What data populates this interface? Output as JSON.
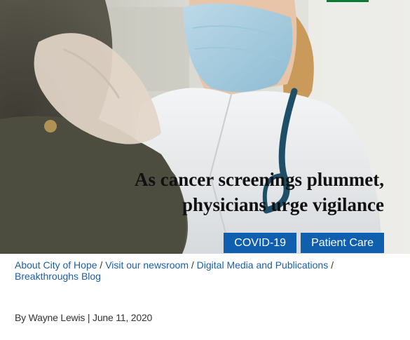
{
  "colors": {
    "tag_bg": "#0f5fae",
    "link": "#1c5fa8",
    "accent_green": "#0a7a3a",
    "headline": "#111111"
  },
  "hero": {
    "headline_line1": "As cancer screenings plummet,",
    "headline_line2": "physicians urge vigilance",
    "tags": [
      "COVID-19",
      "Patient Care"
    ]
  },
  "breadcrumb": {
    "items": [
      "About City of Hope",
      "Visit our newsroom",
      "Digital Media and Publications",
      "Breakthroughs Blog"
    ],
    "separator": "/"
  },
  "byline": {
    "author": "By Wayne Lewis",
    "divider": "|",
    "date": "June 11, 2020"
  }
}
